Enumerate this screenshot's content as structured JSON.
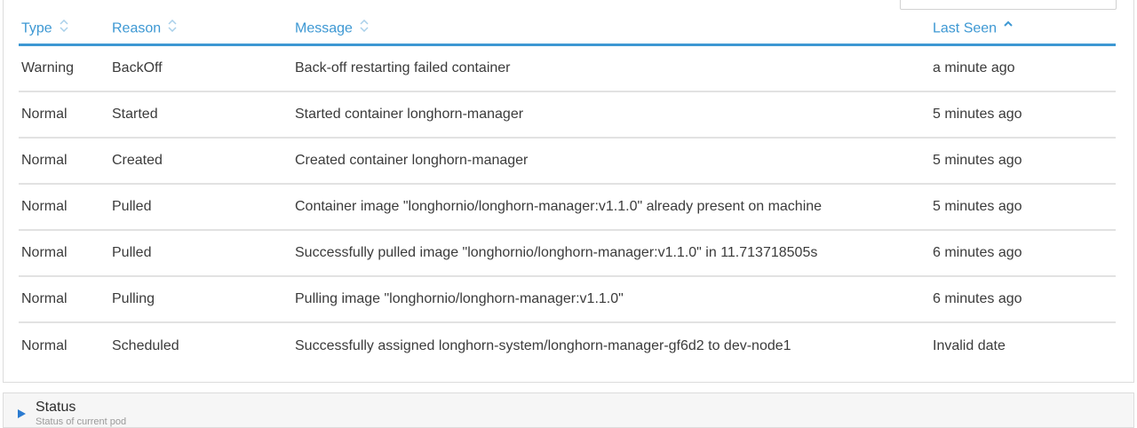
{
  "table": {
    "columns": [
      {
        "label": "Type",
        "sort": "unsorted"
      },
      {
        "label": "Reason",
        "sort": "unsorted"
      },
      {
        "label": "Message",
        "sort": "unsorted"
      },
      {
        "label": "Last Seen",
        "sort": "ascending"
      }
    ],
    "rows": [
      {
        "type": "Warning",
        "reason": "BackOff",
        "message": "Back-off restarting failed container",
        "last_seen": "a minute ago"
      },
      {
        "type": "Normal",
        "reason": "Started",
        "message": "Started container longhorn-manager",
        "last_seen": "5 minutes ago"
      },
      {
        "type": "Normal",
        "reason": "Created",
        "message": "Created container longhorn-manager",
        "last_seen": "5 minutes ago"
      },
      {
        "type": "Normal",
        "reason": "Pulled",
        "message": "Container image \"longhornio/longhorn-manager:v1.1.0\" already present on machine",
        "last_seen": "5 minutes ago"
      },
      {
        "type": "Normal",
        "reason": "Pulled",
        "message": "Successfully pulled image \"longhornio/longhorn-manager:v1.1.0\" in 11.713718505s",
        "last_seen": "6 minutes ago"
      },
      {
        "type": "Normal",
        "reason": "Pulling",
        "message": "Pulling image \"longhornio/longhorn-manager:v1.1.0\"",
        "last_seen": "6 minutes ago"
      },
      {
        "type": "Normal",
        "reason": "Scheduled",
        "message": "Successfully assigned longhorn-system/longhorn-manager-gf6d2 to dev-node1",
        "last_seen": "Invalid date"
      }
    ]
  },
  "status_section": {
    "title": "Status",
    "subtitle": "Status of current pod",
    "expanded": false
  },
  "colors": {
    "accent": "#3d98d3",
    "toggle": "#2b7bd0",
    "text": "#3b3b3b",
    "divider": "#e2e2e2"
  },
  "icons": {
    "sort_unsorted": "sort-both-icon",
    "sort_ascending": "sort-up-icon",
    "collapsed_toggle": "triangle-right-icon"
  }
}
